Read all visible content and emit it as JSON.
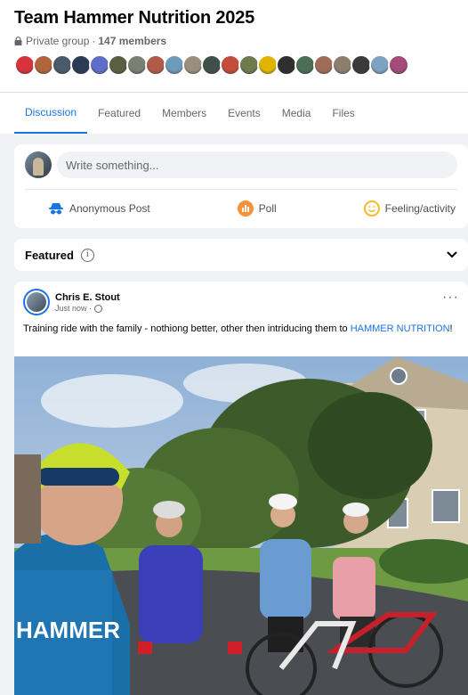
{
  "group": {
    "title": "Team Hammer Nutrition 2025",
    "privacy": "Private group",
    "separator": "·",
    "members": "147 members"
  },
  "member_avatars": [
    "#d6333b",
    "#b0643c",
    "#4a5a6a",
    "#2b3a55",
    "#5e6ec8",
    "#5a5f44",
    "#7a7f74",
    "#b05a4a",
    "#6d9ab8",
    "#9a8f7c",
    "#3f5048",
    "#c44c3a",
    "#6f7a4e",
    "#e1b400",
    "#2f2f2f",
    "#4c6e55",
    "#a06c5a",
    "#8c7f70",
    "#3a3a3a",
    "#7da2c2",
    "#a44b7a"
  ],
  "tabs": [
    {
      "label": "Discussion",
      "active": true
    },
    {
      "label": "Featured",
      "active": false
    },
    {
      "label": "Members",
      "active": false
    },
    {
      "label": "Events",
      "active": false
    },
    {
      "label": "Media",
      "active": false
    },
    {
      "label": "Files",
      "active": false
    }
  ],
  "composer": {
    "placeholder": "Write something...",
    "actions": [
      {
        "label": "Anonymous Post",
        "icon": "anonymous-icon",
        "color": "#1b74e4"
      },
      {
        "label": "Poll",
        "icon": "poll-icon",
        "color": "#f7923b"
      },
      {
        "label": "Feeling/activity",
        "icon": "smiley-icon",
        "color": "#f7b928"
      }
    ]
  },
  "featured": {
    "label": "Featured",
    "info": "i"
  },
  "post": {
    "author": "Chris E. Stout",
    "time": "Just now ·",
    "text": "Training ride with the family - nothiong better, other then intriducing them to ",
    "link": "HAMMER NUTRITION",
    "text_end": "!",
    "more": "···",
    "jersey_text": "HAMMER"
  },
  "colors": {
    "accent": "#1b74e4",
    "background": "#f0f2f5"
  }
}
